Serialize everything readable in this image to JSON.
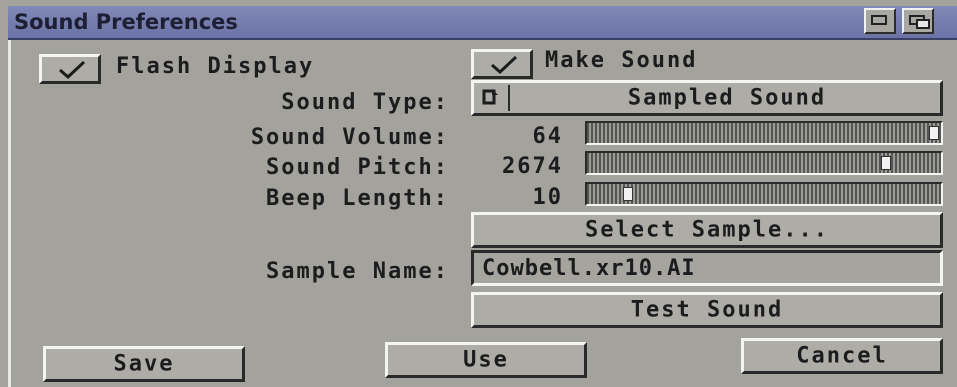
{
  "window": {
    "title": "Sound Preferences"
  },
  "options": {
    "flash_display": {
      "label": "Flash Display",
      "checked": true
    },
    "make_sound": {
      "label": "Make Sound",
      "checked": true
    }
  },
  "sound_type": {
    "label": "Sound Type:",
    "value": "Sampled Sound"
  },
  "sliders": {
    "volume": {
      "label": "Sound Volume:",
      "value": "64",
      "fraction": 1.0
    },
    "pitch": {
      "label": "Sound Pitch:",
      "value": "2674",
      "fraction": 0.86
    },
    "beep_length": {
      "label": "Beep Length:",
      "value": "10",
      "fraction": 0.1
    }
  },
  "sample": {
    "select_label": "Select Sample...",
    "name_label": "Sample Name:",
    "name_value": "Cowbell.xr10.AI",
    "test_label": "Test Sound"
  },
  "actions": {
    "save": "Save",
    "use": "Use",
    "cancel": "Cancel"
  },
  "colors": {
    "title_bar": "#747cae",
    "panel": "#a4a29c",
    "highlight": "#f4f4f2",
    "shadow": "#2a2a2a"
  },
  "icons": [
    "check-icon",
    "cycle-icon",
    "depth-gadget-icon",
    "zoom-gadget-icon"
  ]
}
